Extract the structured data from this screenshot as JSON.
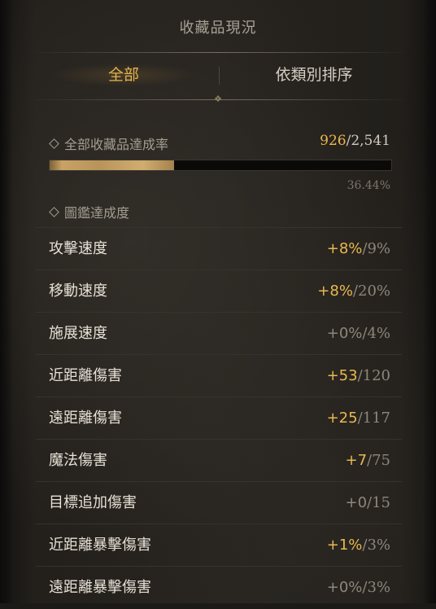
{
  "header": {
    "title": "收藏品現況"
  },
  "tabs": [
    {
      "label": "全部",
      "active": true
    },
    {
      "label": "依類別排序",
      "active": false
    }
  ],
  "summary": {
    "label": "全部收藏品達成率",
    "current": "926",
    "separator": "/",
    "total": "2,541",
    "percent": "36.44%",
    "progress_fraction": 0.3644
  },
  "codex": {
    "label": "圖鑑達成度"
  },
  "stats": [
    {
      "label": "攻擊速度",
      "bonus": "+8%",
      "max": "/9%",
      "active": true
    },
    {
      "label": "移動速度",
      "bonus": "+8%",
      "max": "/20%",
      "active": true
    },
    {
      "label": "施展速度",
      "bonus": "+0%",
      "max": "/4%",
      "active": false
    },
    {
      "label": "近距離傷害",
      "bonus": "+53",
      "max": "/120",
      "active": true
    },
    {
      "label": "遠距離傷害",
      "bonus": "+25",
      "max": "/117",
      "active": true
    },
    {
      "label": "魔法傷害",
      "bonus": "+7",
      "max": "/75",
      "active": true
    },
    {
      "label": "目標追加傷害",
      "bonus": "+0",
      "max": "/15",
      "active": false
    },
    {
      "label": "近距離暴擊傷害",
      "bonus": "+1%",
      "max": "/3%",
      "active": true
    },
    {
      "label": "遠距離暴擊傷害",
      "bonus": "+0%",
      "max": "/3%",
      "active": false
    }
  ],
  "colors": {
    "accent": "#e9b84f",
    "text": "#e7e1d6",
    "muted": "#8d877c"
  }
}
